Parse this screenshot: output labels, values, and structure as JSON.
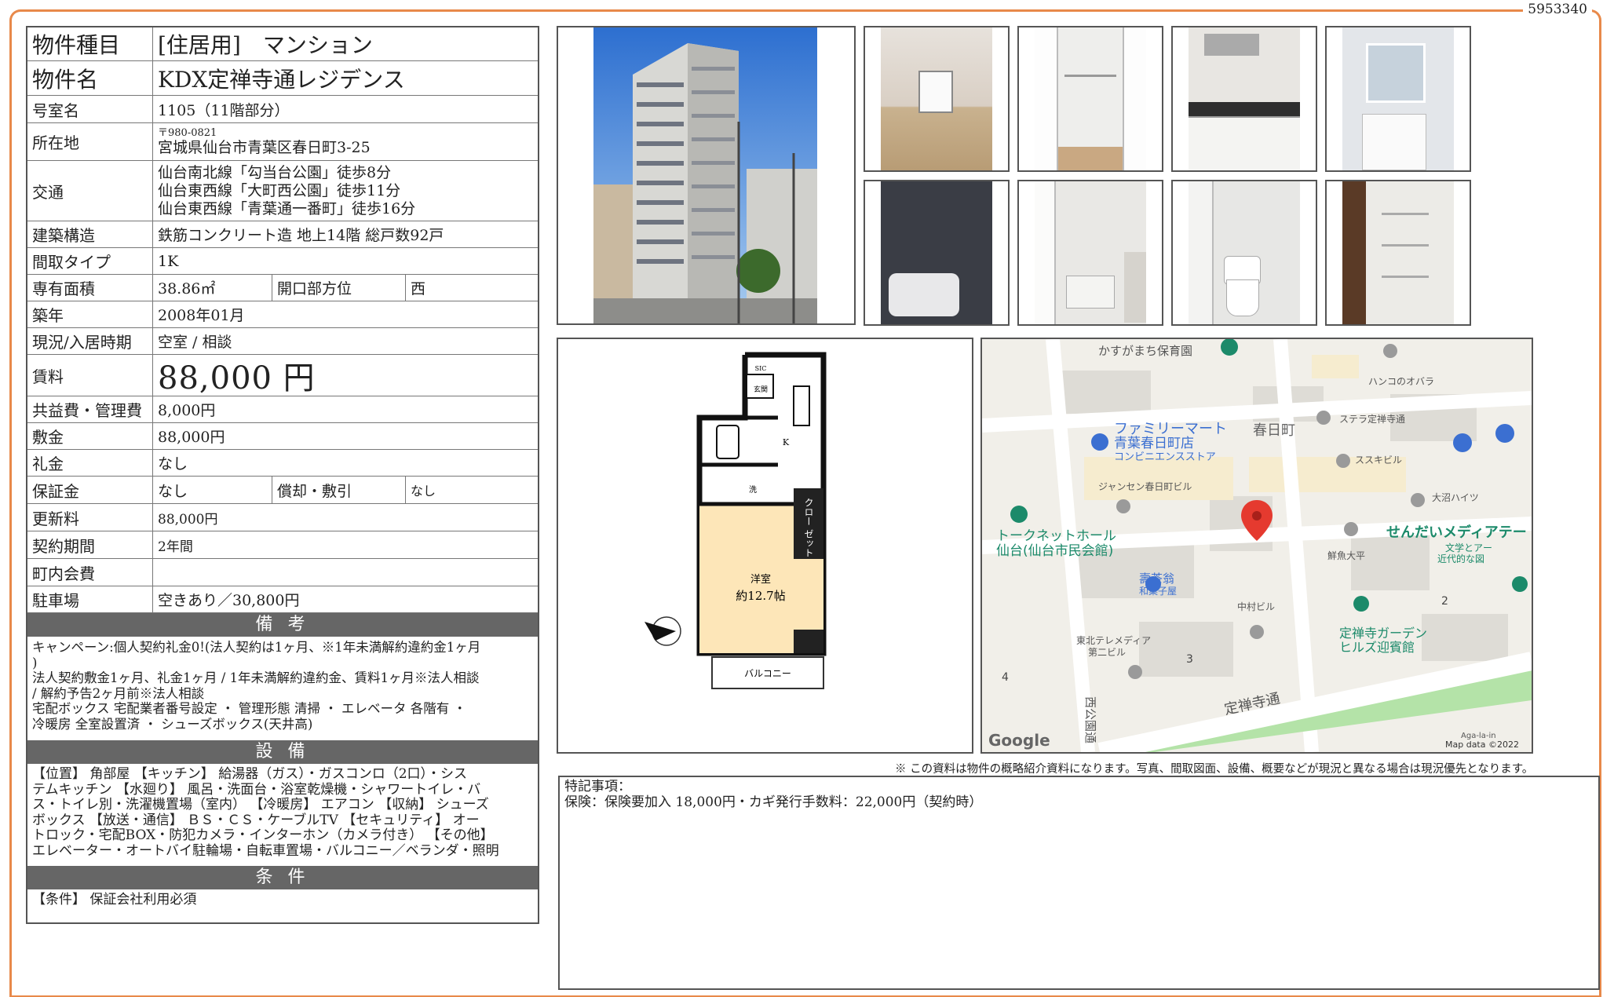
{
  "doc_id": "5953340",
  "property": {
    "type_label": "物件種目",
    "type_value": "[住居用]　マンション",
    "name_label": "物件名",
    "name_value": "KDX定禅寺通レジデンス",
    "room_label": "号室名",
    "room_value": "1105（11階部分）",
    "address_label": "所在地",
    "postal": "〒980-0821",
    "address": "宮城県仙台市青葉区春日町3-25",
    "transit_label": "交通",
    "transit": [
      "仙台南北線「勾当台公園」徒歩8分",
      "仙台東西線「大町西公園」徒歩11分",
      "仙台東西線「青葉通一番町」徒歩16分"
    ],
    "structure_label": "建築構造",
    "structure_value": "鉄筋コンクリート造 地上14階 総戸数92戸",
    "layout_label": "間取タイプ",
    "layout_value": "1K",
    "area_label": "専有面積",
    "area_value": "38.86㎡",
    "direction_label": "開口部方位",
    "direction_value": "西",
    "built_label": "築年",
    "built_value": "2008年01月",
    "status_label": "現況/入居時期",
    "status_value": "空室 /  相談",
    "rent_label": "賃料",
    "rent_value": "88,000 円",
    "fee_label": "共益費・管理費",
    "fee_value": "8,000円",
    "deposit_label": "敷金",
    "deposit_value": "88,000円",
    "keymoney_label": "礼金",
    "keymoney_value": "なし",
    "guarantee_label": "保証金",
    "guarantee_value": "なし",
    "amort_label": "償却・敷引",
    "amort_value": "なし",
    "renewal_label": "更新料",
    "renewal_value": "88,000円",
    "contract_label": "契約期間",
    "contract_value": "2年間",
    "town_label": "町内会費",
    "town_value": "",
    "parking_label": "駐車場",
    "parking_value": "空きあり／30,800円"
  },
  "remarks": {
    "title": "備 考",
    "lines": [
      "キャンペーン:個人契約礼金0!(法人契約は1ヶ月、※1年未満解約違約金1ヶ月",
      ")",
      "法人契約敷金1ヶ月、礼金1ヶ月 / 1年未満解約違約金、賃料1ヶ月※法人相談",
      " / 解約予告2ヶ月前※法人相談",
      "宅配ボックス 宅配業者番号設定 ・ 管理形態 清掃 ・ エレベータ 各階有 ・",
      "冷暖房 全室設置済 ・ シューズボックス(天井高)"
    ]
  },
  "facilities": {
    "title": "設 備",
    "lines": [
      "【位置】 角部屋 【キッチン】 給湯器（ガス）・ガスコンロ（2口）・シス",
      "テムキッチン 【水廻り】 風呂・洗面台・浴室乾燥機・シャワートイレ・バ",
      "ス・トイレ別・洗濯機置場（室内） 【冷暖房】 エアコン 【収納】 シューズ",
      "ボックス 【放送・通信】 ＢＳ・ＣＳ・ケーブルTV 【セキュリティ】 オー",
      "トロック・宅配BOX・防犯カメラ・インターホン（カメラ付き） 【その他】",
      "エレベーター・オートバイ駐輪場・自転車置場・バルコニー／ベランダ・照明"
    ]
  },
  "conditions": {
    "title": "条 件",
    "text": "【条件】 保証会社利用必須"
  },
  "floorplan": {
    "closet": "クロー ゼット",
    "room": "洋室",
    "size": "約12.7帖",
    "balcony": "バルコニー",
    "entrance": "玄関",
    "kitchen": "K",
    "wash": "洗",
    "sic": "SIC"
  },
  "map": {
    "labels": [
      "かすがまち保育園",
      "ハンコのオバラ",
      "ファミリーマート",
      "青葉春日町店",
      "コンビニエンスストア",
      "春日町",
      "ステラ定禅寺通",
      "ススキビル",
      "ジャンセン春日町ビル",
      "大沼ハイツ",
      "トークネットホール",
      "仙台(仙台市民会館)",
      "せんだいメディアテー",
      "文学とアー",
      "近代的な図",
      "鮮魚大平",
      "壽茶翁",
      "和菓子屋",
      "中村ビル",
      "東北テレメディア",
      "第二ビル",
      "定禅寺ガーデン",
      "ヒルズ迎賓館",
      "定禅寺通",
      "西公園通",
      "Google",
      "Map data ©2022",
      "Aga-la-in",
      "2",
      "3",
      "4"
    ]
  },
  "disclaimer": "※ この資料は物件の概略紹介資料になります。写真、間取図面、設備、概要などが現況と異なる場合は現況優先となります。",
  "special": {
    "title": "特記事項：",
    "text": "保険：保険要加入 18,000円・カギ発行手数料：22,000円（契約時）"
  }
}
